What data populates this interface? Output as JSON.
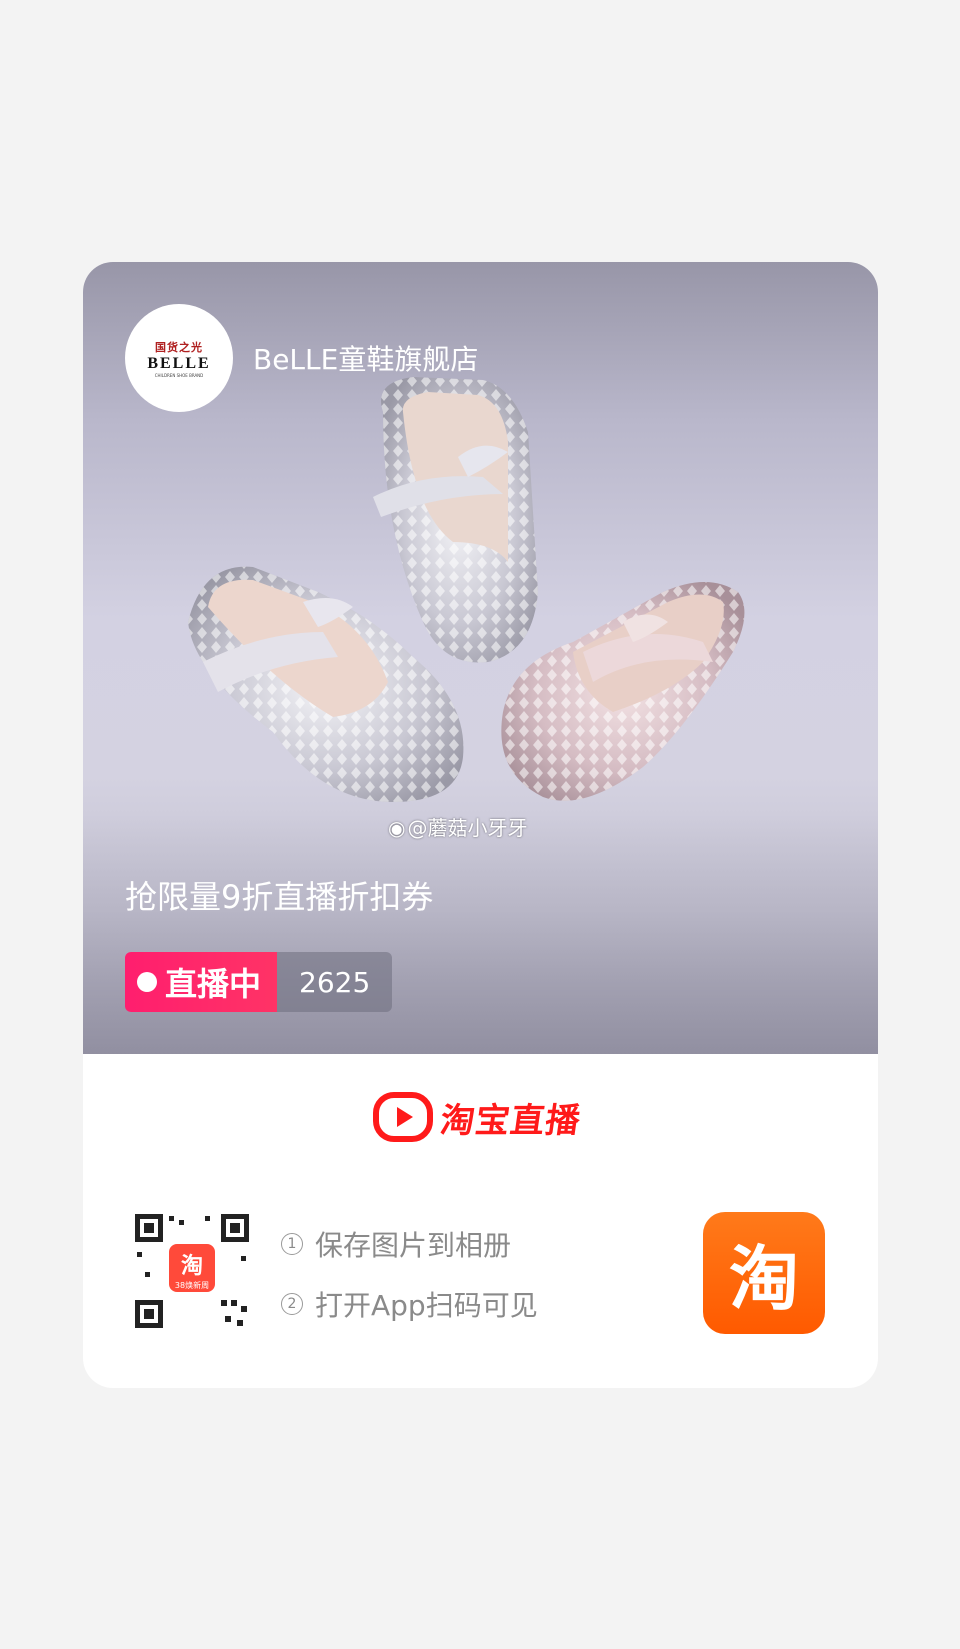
{
  "store": {
    "name": "BeLLE童鞋旗舰店",
    "logo_top": "国货之光",
    "logo_main": "BELLE",
    "logo_sub": "CHILDREN SHOE BRAND"
  },
  "watermark": "@蘑菇小牙牙",
  "promo_text": "抢限量9折直播折扣券",
  "live": {
    "status": "直播中",
    "viewers": "2625"
  },
  "brand": {
    "name": "淘宝直播",
    "icon": "play-icon",
    "color": "#ff1a1a"
  },
  "qr": {
    "center_label": "淘",
    "center_sub": "38焕新周"
  },
  "instructions": {
    "step1_num": "1",
    "step1": "保存图片到相册",
    "step2_num": "2",
    "step2": "打开App扫码可见"
  },
  "app_icon": {
    "label": "淘",
    "color": "#ff6a00"
  }
}
